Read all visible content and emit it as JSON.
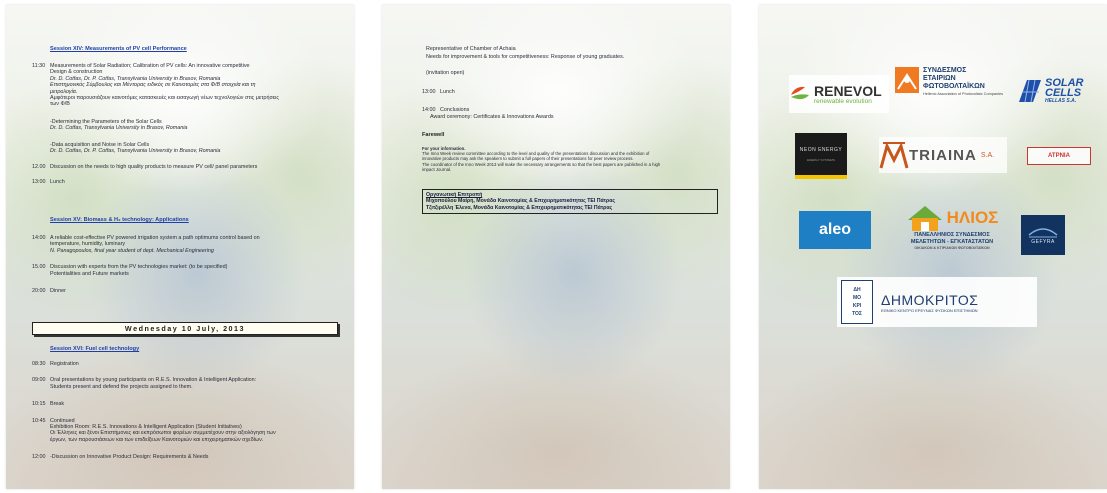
{
  "page1": {
    "session14_title": "Session XIV: Measurements of PV cell Performance",
    "items": [
      {
        "time": "11:30",
        "lines": [
          "Measurements of Solar Radiation; Calibration of PV cells: An innovative competitive",
          "Design & construction"
        ],
        "italic": [
          "Dr. D. Cotfas, Dr. P. Cotfas, Transylvania University in Brasov, Romania",
          "Επιστημονικός Σύμβουλος και Μέντορας ειδικός σε Καινοτομίες στα Φ/Β στοιχεία και τη",
          "μετρολογία."
        ],
        "more": [
          "Αμφότεροι παρουσιάζουν καινοτόμες κατασκευές και εισαγωγή νέων τεχνολογιών στις μετρήσεις",
          "των Φ/Β"
        ]
      },
      {
        "time": "",
        "lines": [
          "-Determining the Parameters of the Solar Cells"
        ],
        "italic": [
          "Dr. D. Cotfas, Transylvania University in Brasov, Romania"
        ],
        "more": []
      },
      {
        "time": "",
        "lines": [
          "-Data acquisition and Noise in Solar Cells"
        ],
        "italic": [
          "Dr. D. Cotfas, Dr. P. Cotfas, Transylvania University in Brasov, Romania"
        ],
        "more": []
      },
      {
        "time": "12.00",
        "lines": [
          "Discussion on the needs to high quality products to measure PV cell/ panel parameters"
        ],
        "italic": [],
        "more": []
      },
      {
        "time": "13:00",
        "lines": [
          "Lunch"
        ],
        "italic": [],
        "more": []
      }
    ],
    "session15_title": "Session XV: Biomass & H₂ technology: Applications",
    "items2": [
      {
        "time": "14:00",
        "lines": [
          "A reliable cost-effective PV powered irrigation system a path optimums control based on",
          "temperature, humidity, luminary"
        ],
        "italic": [
          "N. Panagopoulos, final year student of dept. Mechanical Engineering"
        ],
        "more": []
      },
      {
        "time": "15.00",
        "lines": [
          "Discussion with experts from the PV technologies market: (to be specified)",
          "Potentialities and Future markets"
        ],
        "italic": [],
        "more": []
      },
      {
        "time": "20:00",
        "lines": [
          "Dinner"
        ],
        "italic": [],
        "more": []
      }
    ],
    "day_banner": "Wednesday 10 July, 2013",
    "session16_title": "Session XVI: Fuel cell technology",
    "items3": [
      {
        "time": "08:30",
        "lines": [
          "Registration"
        ],
        "italic": [],
        "more": []
      },
      {
        "time": "09:00",
        "lines": [
          "Oral presentations by young participants on R.E.S. Innovation & Intelligent Application:",
          "Students present and defend the projects assigned to them."
        ],
        "italic": [],
        "more": []
      },
      {
        "time": "10:15",
        "lines": [
          "Break"
        ],
        "italic": [],
        "more": []
      },
      {
        "time": "10:45",
        "lines": [
          "Continued",
          "Exhibition Room: R.E.S. Innovations & Intelligent Application (Student Initiatives)",
          "Οι Έλληνες και ξένοι Επιστήμονες και εκπρόσωποι φορέων συμμετέχουν στην αξιολόγηση των",
          "έργων, των παρουσιάσεων και των επιδείξεων Καινοτομιών και επιχειρηματικών σχεδίων."
        ],
        "italic": [],
        "more": []
      },
      {
        "time": "12:00",
        "lines": [
          "-Discussion on Innovative Product Design: Requirements & Needs"
        ],
        "italic": [],
        "more": []
      }
    ]
  },
  "page2": {
    "top_lines": [
      "Representative of Chamber of Achaia",
      "Needs for improvement & tools for competitiveness: Response of young graduates."
    ],
    "invitation": "(invitation open)",
    "lunch_time": "13:00",
    "lunch": "Lunch",
    "concl_time": "14:00",
    "conclusions": "Conclusions",
    "award": "Award ceremony: Certificates & Innovations Awards",
    "farewell": "Farewell",
    "info_head": "For your information.",
    "info_lines": [
      "The Inno Week review committee according to the level and quality of the presentations discussion and the exhibition of",
      "innovative products may ask the speakers to submit a full papers of their presentations for peer review process.",
      "The coordinator of the Inno Week 2013 will make the necessary arrangements so that the best papers are   published in a high",
      "impact Journal."
    ],
    "committee_head": "Οργανωτική Επιτροπή",
    "committee_lines": [
      "Μιχοπούλου Μαίρη, Μονάδα Καινοτομίας & Επιχειρηματικότητας ΤΕΙ Πάτρας",
      "Τζιτζιρέλλη Έλενα, Μονάδα Καινοτομίας & Επιχειρηματικότητας ΤΕΙ Πάτρας"
    ]
  },
  "page3": {
    "renevol_name": "RENEVOL",
    "renevol_tag": "renewable evolution",
    "syndesmos_lines": [
      "ΣΥΝΔΕΣΜΟΣ",
      "ΕΤΑΙΡΙΩΝ",
      "ΦΩΤΟΒΟΛΤΑΪΚΩΝ"
    ],
    "syndesmos_en": "Hellenic Association of Photovoltaic Companies",
    "solar_lines": [
      "SOLAR",
      "CELLS"
    ],
    "solar_sub": "HELLAS S.A.",
    "neon_name": "NEON ENERGY",
    "neon_sub": "ENERGY SYSTEMS",
    "triaina_name": "TRIAINA",
    "triaina_sa": "S.A.",
    "atrnia_name": "ATPNIA",
    "aleo_name": "aleo",
    "ilios_name": "ΗΛΙΟΣ",
    "ilios_lines": [
      "ΠΑΝΕΛΛΗΝΙΟΣ ΣΥΝΔΕΣΜΟΣ",
      "ΜΕΛΕΤΗΤΩΝ - ΕΓΚΑΤΑΣΤΑΤΩΝ"
    ],
    "ilios_sub": "ΟΙΚΙΑΚΩΝ & ΚΤΙΡΙΑΚΩΝ ΦΩΤΟΒΟΛΤΑΪΚΩΝ",
    "gefyra_name": "GEFYRA",
    "dimokritos_name": "ΔΗΜΟΚΡΙΤΟΣ",
    "dimokritos_sub": "ΕΘΝΙΚΟ ΚΕΝΤΡΟ ΕΡΕΥΝΑΣ ΦΥΣΙΚΩΝ ΕΠΙΣΤΗΜΩΝ",
    "dimokritos_mark": [
      "ΔΗ",
      "ΜΟ",
      "ΚΡΙ",
      "ΤΟΣ"
    ]
  },
  "colors": {
    "session_blue": "#1f3fa8",
    "text": "#2b2b3a"
  }
}
